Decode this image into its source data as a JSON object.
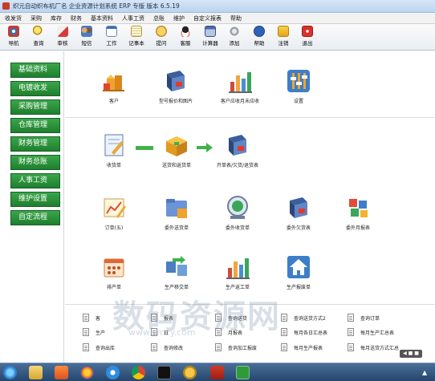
{
  "window": {
    "title": "织元自动织布机厂名 企业资源计划系统 ERP 专版  版本 6.5.19"
  },
  "menu": [
    "收发货",
    "采购",
    "库存",
    "财务",
    "基本资料",
    "人事工资",
    "总账",
    "维护",
    "自定义报表",
    "帮助"
  ],
  "toolbar": [
    {
      "label": "导航",
      "icon": "compass-icon"
    },
    {
      "label": "查询",
      "icon": "search-icon"
    },
    {
      "label": "审核",
      "icon": "approve-icon"
    },
    {
      "label": "短信",
      "icon": "users-icon"
    },
    {
      "label": "工作",
      "icon": "calendar-icon"
    },
    {
      "label": "记事本",
      "icon": "notepad-icon"
    },
    {
      "label": "提问",
      "icon": "question-icon"
    },
    {
      "label": "客服",
      "icon": "qq-icon"
    },
    {
      "label": "计算器",
      "icon": "calculator-icon"
    },
    {
      "label": "添加",
      "icon": "gear-icon"
    },
    {
      "label": "帮助",
      "icon": "help-icon"
    },
    {
      "label": "注销",
      "icon": "logout-icon"
    },
    {
      "label": "退出",
      "icon": "exit-icon"
    }
  ],
  "sidebar": [
    "基础资料",
    "电镀收发",
    "采购管理",
    "仓库管理",
    "财务管理",
    "财务总账",
    "人事工资",
    "维护设置",
    "自定流程"
  ],
  "modules": {
    "row1": [
      "客户",
      "型号报价和图片",
      "客户应收月未应收",
      "设置"
    ],
    "row2": [
      "收货单",
      "送货和返货单",
      "开单表/欠货/退货表"
    ],
    "row3": [
      "订单(五)",
      "委外送货单",
      "委外收货单",
      "委外欠货表",
      "委外月报表"
    ],
    "row4": [
      "排产单",
      "生产移交单",
      "生产返工单",
      "生产报废单"
    ]
  },
  "reports": {
    "col1": [
      "客",
      "生产",
      "查询出库"
    ],
    "col2": [
      "报表",
      "日",
      "查询修改"
    ],
    "col3": [
      "查询送货",
      "月报表",
      "查询加工报废"
    ],
    "col4": [
      "查询送货方式2",
      "每月各日汇总表",
      "每月生产报表"
    ],
    "col5": [
      "查询订单",
      "每月生产汇总表",
      "每月送货方式汇总"
    ]
  },
  "watermark": {
    "main": "数码资源网",
    "sub": "www.smzy.com"
  },
  "tray": {
    "widget": "◀ ■ ■"
  },
  "colors": {
    "sidebar_green": "#2a8f3a",
    "titlebar": "#c9dcf2",
    "taskbar": "#35587f"
  }
}
